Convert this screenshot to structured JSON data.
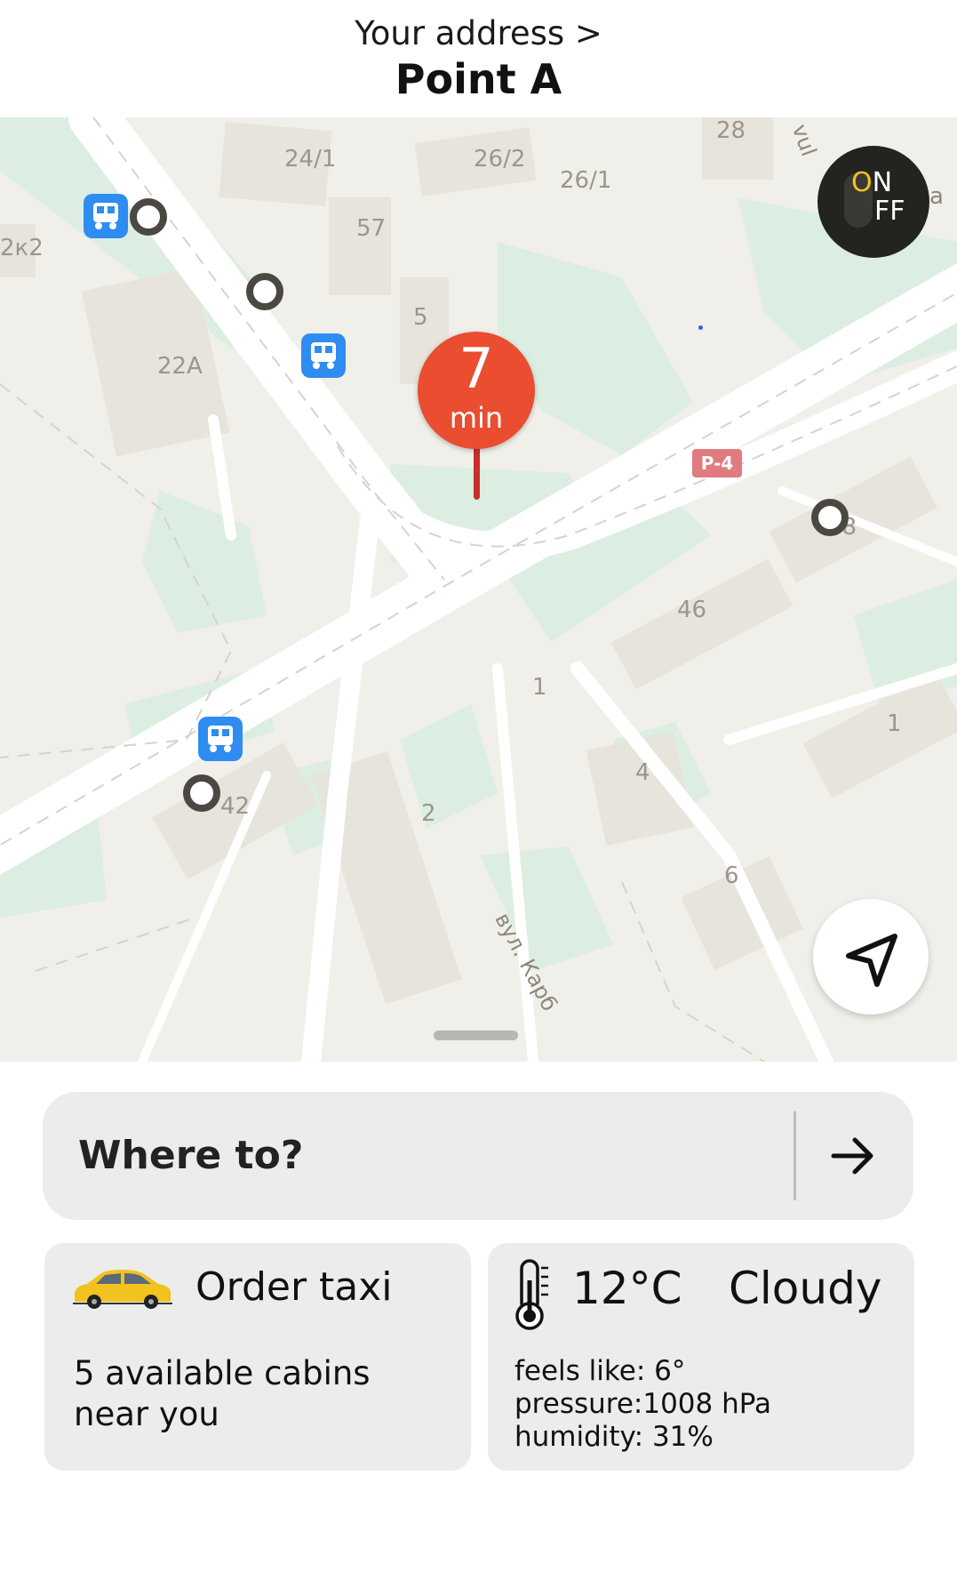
{
  "header": {
    "address_link": "Your address >",
    "address_title": "Point A"
  },
  "map": {
    "house_numbers": [
      "24/1",
      "26/2",
      "26/1",
      "28",
      "57",
      "22A",
      "48",
      "46",
      "1",
      "1",
      "4",
      "42",
      "2",
      "6",
      "2к2",
      "5"
    ],
    "street_labels": [
      "вул. Карб",
      "vul",
      "a"
    ],
    "road_badge": "P-4",
    "pin": {
      "value": "7",
      "unit": "min"
    },
    "toggle": {
      "on_o": "O",
      "on_n": "N",
      "off": "FF"
    },
    "icons": {
      "bus_stop": "bus-stop-icon",
      "stop_marker": "stop-ring-icon",
      "locate": "navigation-arrow-icon",
      "power": "power-toggle-icon"
    },
    "colors": {
      "background": "#f1efe9",
      "park": "#dceee1",
      "pin": "#ea4d2f",
      "bus_icon": "#2f8cf1",
      "road_badge": "#e07b7f"
    }
  },
  "search": {
    "placeholder": "Where to?",
    "icon": "arrow-right-icon"
  },
  "taxi_card": {
    "title": "Order taxi",
    "subtitle": "5 available cabins near you",
    "icon": "taxi-car-icon"
  },
  "weather_card": {
    "temperature": "12°C",
    "condition": "Cloudy",
    "feels_like": "feels like: 6°",
    "pressure": "pressure:1008 hPa",
    "humidity": "humidity: 31%",
    "icon": "thermometer-icon"
  }
}
